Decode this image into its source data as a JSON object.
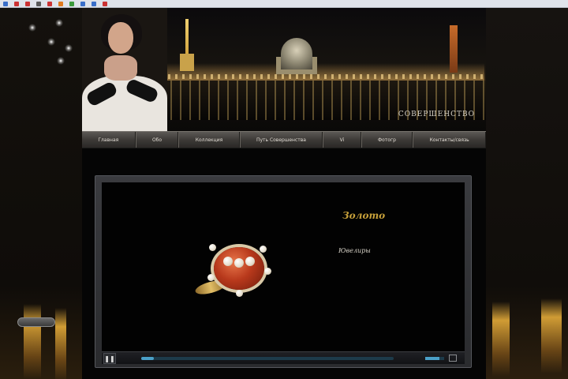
{
  "browser": {
    "bookmarks": [
      {
        "label": "",
        "color": "#3a6fc9"
      },
      {
        "label": "",
        "color": "#cc3333"
      },
      {
        "label": "",
        "color": "#cc3333"
      },
      {
        "label": "",
        "color": "#5a5a5a"
      },
      {
        "label": "",
        "color": "#cc3333"
      },
      {
        "label": "",
        "color": "#e07a1f"
      },
      {
        "label": "",
        "color": "#3c9a3c"
      },
      {
        "label": "",
        "color": "#3a6fc9"
      },
      {
        "label": "",
        "color": "#3a6fc9"
      },
      {
        "label": "",
        "color": "#cc3333"
      }
    ]
  },
  "header": {
    "title": "СОВЕРШЕНСТВО"
  },
  "nav": {
    "items": [
      {
        "label": "Главная"
      },
      {
        "label": "Обо"
      },
      {
        "label": "Коллекция"
      },
      {
        "label": "Путь Совершенства"
      },
      {
        "label": "Vi"
      },
      {
        "label": "Фотогр"
      },
      {
        "label": "Контакты/связь"
      }
    ]
  },
  "player": {
    "gold_word": "Золото",
    "credits_title": "Ювелиры",
    "credits": [
      "",
      "",
      "",
      "",
      "",
      "",
      ""
    ],
    "chapter_label": "",
    "play_icon": "pause-icon",
    "progress": 0.05,
    "volume": 0.75,
    "time": ""
  },
  "colors": {
    "accent": "#4aa0c8",
    "gold": "#c8a13a",
    "nav_bg": "#3d3a37"
  }
}
